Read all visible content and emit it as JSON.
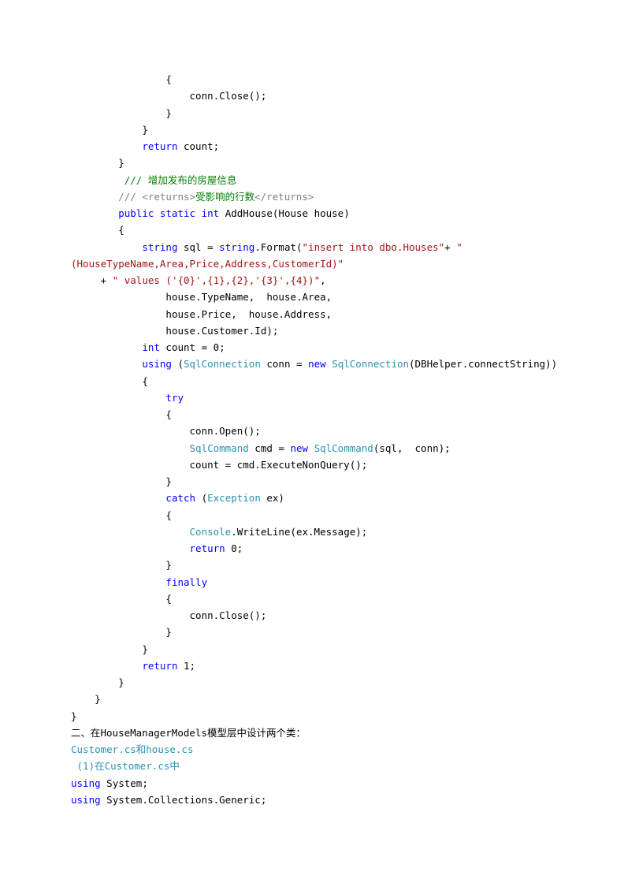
{
  "lines": [
    {
      "indent": 16,
      "segments": [
        {
          "t": "{"
        }
      ]
    },
    {
      "indent": 20,
      "segments": [
        {
          "t": "conn.Close();"
        }
      ]
    },
    {
      "indent": 16,
      "segments": [
        {
          "t": "}"
        }
      ]
    },
    {
      "indent": 12,
      "segments": [
        {
          "t": "}"
        }
      ]
    },
    {
      "indent": 12,
      "segments": [
        {
          "t": "return",
          "c": "kw"
        },
        {
          "t": " count;"
        }
      ]
    },
    {
      "indent": 8,
      "segments": [
        {
          "t": "}"
        }
      ]
    },
    {
      "indent": 9,
      "segments": [
        {
          "t": "/// 增加发布的房屋信息",
          "c": "comment-green"
        }
      ]
    },
    {
      "indent": 8,
      "segments": [
        {
          "t": "/// <returns>",
          "c": "comment-gray"
        },
        {
          "t": "受影响的行数",
          "c": "comment-green"
        },
        {
          "t": "</returns>",
          "c": "comment-gray"
        }
      ]
    },
    {
      "indent": 8,
      "segments": [
        {
          "t": "public",
          "c": "kw"
        },
        {
          "t": " "
        },
        {
          "t": "static",
          "c": "kw"
        },
        {
          "t": " "
        },
        {
          "t": "int",
          "c": "kw"
        },
        {
          "t": " AddHouse(House house)"
        }
      ]
    },
    {
      "indent": 8,
      "segments": [
        {
          "t": "{"
        }
      ]
    },
    {
      "indent": 12,
      "segments": [
        {
          "t": "string",
          "c": "kw"
        },
        {
          "t": " sql = "
        },
        {
          "t": "string",
          "c": "kw"
        },
        {
          "t": ".Format("
        },
        {
          "t": "\"insert into dbo.Houses\"",
          "c": "str"
        },
        {
          "t": "+ "
        },
        {
          "t": "\"",
          "c": "str"
        }
      ]
    },
    {
      "indent": -1,
      "segments": [
        {
          "t": "(HouseTypeName,Area,Price,Address,CustomerId)\"",
          "c": "str"
        }
      ]
    },
    {
      "indent": 5,
      "segments": [
        {
          "t": "+ "
        },
        {
          "t": "\" values ('{0}',{1},{2},'{3}',{4})\"",
          "c": "str"
        },
        {
          "t": ","
        }
      ]
    },
    {
      "indent": 16,
      "segments": [
        {
          "t": "house.TypeName,  house.Area,"
        }
      ]
    },
    {
      "indent": 16,
      "segments": [
        {
          "t": "house.Price,  house.Address,"
        }
      ]
    },
    {
      "indent": 16,
      "segments": [
        {
          "t": "house.Customer.Id);"
        }
      ]
    },
    {
      "indent": 12,
      "segments": [
        {
          "t": "int",
          "c": "kw"
        },
        {
          "t": " count = 0;"
        }
      ]
    },
    {
      "indent": 12,
      "segments": [
        {
          "t": "using",
          "c": "kw"
        },
        {
          "t": " ("
        },
        {
          "t": "SqlConnection",
          "c": "type"
        },
        {
          "t": " conn = "
        },
        {
          "t": "new",
          "c": "kw"
        },
        {
          "t": " "
        },
        {
          "t": "SqlConnection",
          "c": "type"
        },
        {
          "t": "(DBHelper.connectString))"
        }
      ]
    },
    {
      "indent": 12,
      "segments": [
        {
          "t": "{"
        }
      ]
    },
    {
      "indent": 16,
      "segments": [
        {
          "t": "try",
          "c": "kw"
        }
      ]
    },
    {
      "indent": 16,
      "segments": [
        {
          "t": "{"
        }
      ]
    },
    {
      "indent": 20,
      "segments": [
        {
          "t": "conn.Open();"
        }
      ]
    },
    {
      "indent": 20,
      "segments": [
        {
          "t": "SqlCommand",
          "c": "type"
        },
        {
          "t": " cmd = "
        },
        {
          "t": "new",
          "c": "kw"
        },
        {
          "t": " "
        },
        {
          "t": "SqlCommand",
          "c": "type"
        },
        {
          "t": "(sql,  conn);"
        }
      ]
    },
    {
      "indent": 20,
      "segments": [
        {
          "t": "count = cmd.ExecuteNonQuery();"
        }
      ]
    },
    {
      "indent": 16,
      "segments": [
        {
          "t": "}"
        }
      ]
    },
    {
      "indent": 16,
      "segments": [
        {
          "t": "catch",
          "c": "kw"
        },
        {
          "t": " ("
        },
        {
          "t": "Exception",
          "c": "type"
        },
        {
          "t": " ex)"
        }
      ]
    },
    {
      "indent": 16,
      "segments": [
        {
          "t": "{"
        }
      ]
    },
    {
      "indent": 20,
      "segments": [
        {
          "t": "Console",
          "c": "type"
        },
        {
          "t": ".WriteLine(ex.Message);"
        }
      ]
    },
    {
      "indent": 20,
      "segments": [
        {
          "t": "return",
          "c": "kw"
        },
        {
          "t": " 0;"
        }
      ]
    },
    {
      "indent": 16,
      "segments": [
        {
          "t": "}"
        }
      ]
    },
    {
      "indent": 16,
      "segments": [
        {
          "t": "finally",
          "c": "kw"
        }
      ]
    },
    {
      "indent": 16,
      "segments": [
        {
          "t": "{"
        }
      ]
    },
    {
      "indent": 20,
      "segments": [
        {
          "t": "conn.Close();"
        }
      ]
    },
    {
      "indent": 16,
      "segments": [
        {
          "t": "}"
        }
      ]
    },
    {
      "indent": 12,
      "segments": [
        {
          "t": "}"
        }
      ]
    },
    {
      "indent": 12,
      "segments": [
        {
          "t": "return",
          "c": "kw"
        },
        {
          "t": " 1;"
        }
      ]
    },
    {
      "indent": 8,
      "segments": [
        {
          "t": "}"
        }
      ]
    },
    {
      "indent": 4,
      "segments": [
        {
          "t": "}"
        }
      ]
    },
    {
      "indent": 0,
      "segments": [
        {
          "t": "}"
        }
      ]
    },
    {
      "indent": 0,
      "segments": [
        {
          "t": "二、在HouseManagerModels模型层中设计两个类："
        }
      ]
    },
    {
      "indent": 0,
      "segments": [
        {
          "t": "Customer.cs和house.cs",
          "c": "type"
        }
      ]
    },
    {
      "indent": 1,
      "segments": [
        {
          "t": "(1)在Customer.cs中",
          "c": "type"
        }
      ]
    },
    {
      "indent": 0,
      "segments": [
        {
          "t": "using",
          "c": "kw"
        },
        {
          "t": " System;"
        }
      ]
    },
    {
      "indent": 0,
      "segments": [
        {
          "t": "using",
          "c": "kw"
        },
        {
          "t": " System.Collections.Generic;"
        }
      ]
    }
  ]
}
